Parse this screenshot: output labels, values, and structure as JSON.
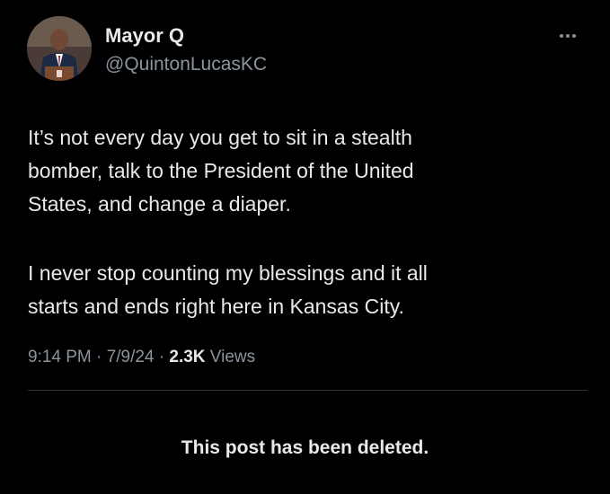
{
  "author": {
    "display_name": "Mayor Q",
    "handle": "@QuintonLucasKC",
    "avatar_icon": "profile-photo"
  },
  "post": {
    "paragraph_1_lines": [
      "It’s not every day you get to sit in a stealth",
      "bomber, talk to the President of the United",
      "States, and change a diaper."
    ],
    "paragraph_2_lines": [
      "I never stop counting my blessings and it all",
      "starts and ends right here in Kansas City."
    ]
  },
  "meta": {
    "time": "9:14 PM",
    "separator": "·",
    "date": "7/9/24",
    "views_count": "2.3K",
    "views_label": "Views"
  },
  "notice": {
    "deleted_text": "This post has been deleted."
  },
  "colors": {
    "background": "#000000",
    "primary_text": "#e7e9ea",
    "secondary_text": "#8b949e",
    "divider": "#2f3336"
  }
}
